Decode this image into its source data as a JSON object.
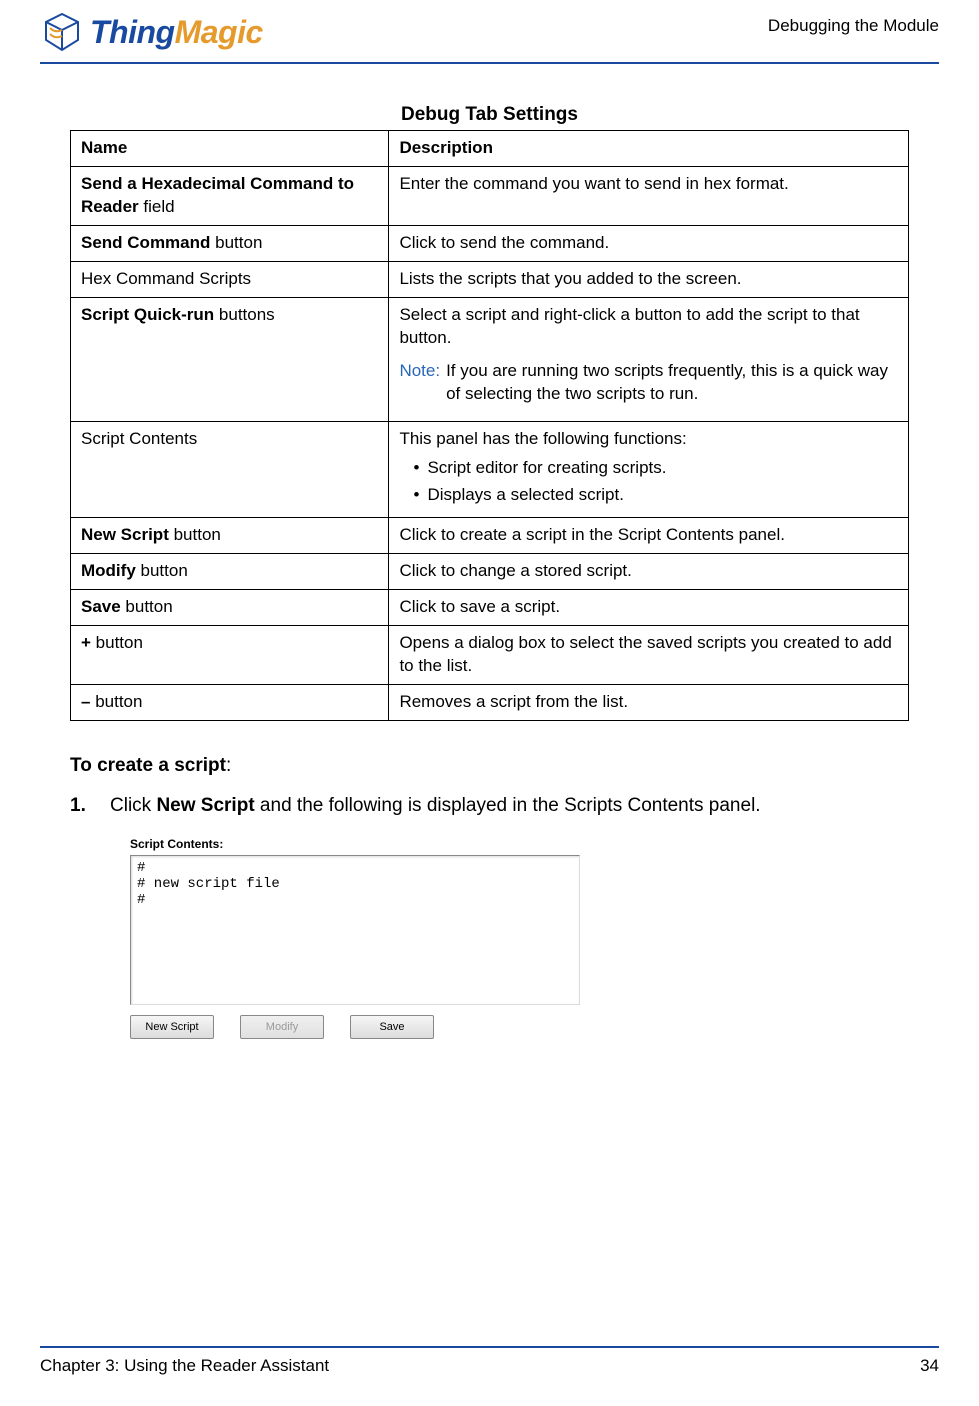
{
  "header": {
    "logo_brand": "Thing",
    "logo_accent": "Magic",
    "running_title": "Debugging the Module"
  },
  "table": {
    "title": "Debug Tab Settings",
    "col_name": "Name",
    "col_desc": "Description",
    "rows": [
      {
        "name_bold": "Send a Hexadecimal Command to Reader",
        "name_plain": " field",
        "desc": "Enter the command you want to send in hex format."
      },
      {
        "name_bold": "Send Command",
        "name_plain": " button",
        "desc": "Click to send the command."
      },
      {
        "name_bold": "",
        "name_plain": "Hex Command Scripts",
        "desc": "Lists the scripts that you added to the screen."
      },
      {
        "name_bold": "Script Quick-run",
        "name_plain": " buttons",
        "desc": "Select a script and right-click a button to add the script to that button.",
        "note_label": "Note:",
        "note_body": "If you are running two scripts frequently, this is a quick way of selecting the two scripts to run."
      },
      {
        "name_bold": "",
        "name_plain": "Script Contents",
        "desc": "This panel has the following functions:",
        "bullets": [
          "Script editor for creating scripts.",
          "Displays a selected script."
        ]
      },
      {
        "name_bold": "New Script",
        "name_plain": " button",
        "desc": "Click to create a script in the Script Contents panel."
      },
      {
        "name_bold": "Modify",
        "name_plain": " button",
        "desc": "Click to change a stored script."
      },
      {
        "name_bold": "Save",
        "name_plain": " button",
        "desc": "Click to save a script."
      },
      {
        "name_bold": "+",
        "name_plain": " button",
        "desc": "Opens a dialog box to select the saved scripts you created to add to the list."
      },
      {
        "name_bold": "–",
        "name_plain": " button",
        "desc": "Removes a script from the list."
      }
    ]
  },
  "section": {
    "heading_bold": "To create a script",
    "heading_trail": ":",
    "step_num": "1.",
    "step_pre": "Click ",
    "step_bold": "New Script",
    "step_post": " and the following is displayed in the Scripts Contents panel."
  },
  "screenshot": {
    "label": "Script Contents:",
    "text": "#\n# new script file\n#",
    "btn_new": "New Script",
    "btn_modify": "Modify",
    "btn_save": "Save"
  },
  "footer": {
    "chapter": "Chapter 3: Using the Reader Assistant",
    "page": "34"
  }
}
